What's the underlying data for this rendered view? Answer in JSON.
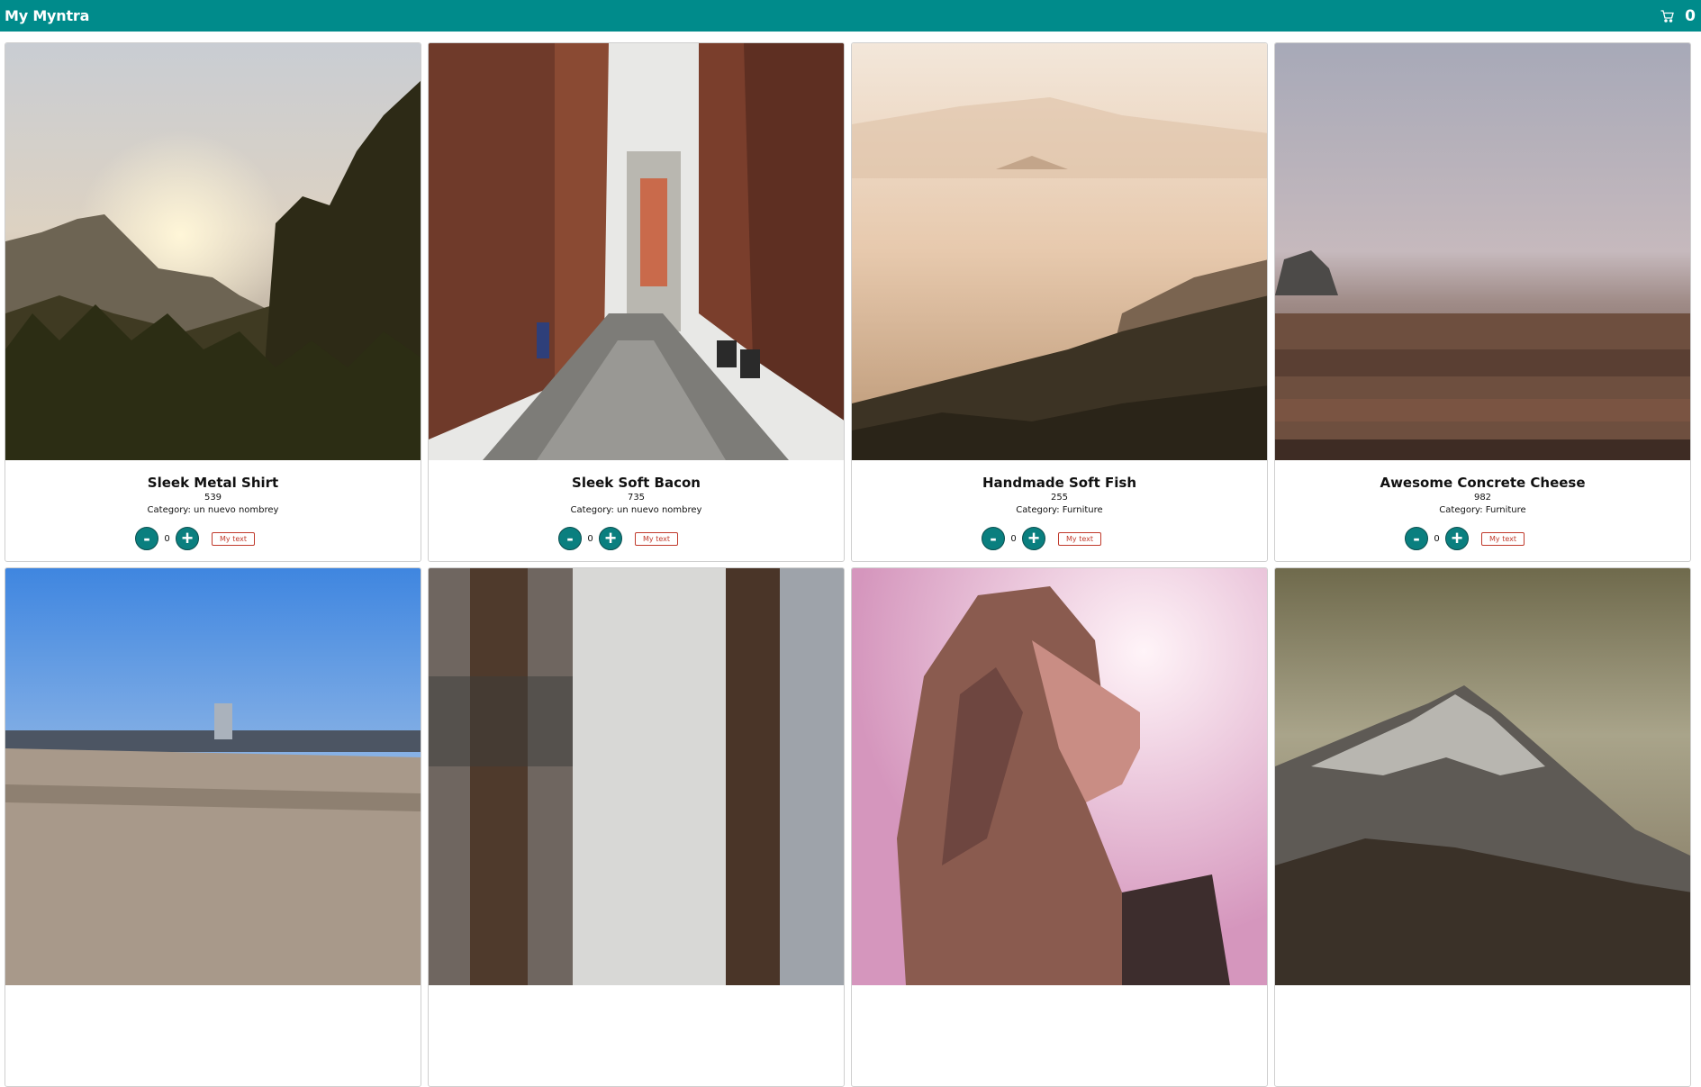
{
  "header": {
    "title": "My Myntra",
    "cart_icon": "cart-icon",
    "cart_count": "0",
    "background": "#008b8b"
  },
  "products": [
    {
      "name": "Sleek Metal Shirt",
      "price": "539",
      "category": "Category: un nuevo nombrey",
      "quantity": "0",
      "minus_label": "-",
      "plus_label": "+",
      "extra_button": "My text",
      "image": "mountain-sunset-photo"
    },
    {
      "name": "Sleek Soft Bacon",
      "price": "735",
      "category": "Category: un nuevo nombrey",
      "quantity": "0",
      "minus_label": "-",
      "plus_label": "+",
      "extra_button": "My text",
      "image": "brick-alley-photo"
    },
    {
      "name": "Handmade Soft Fish",
      "price": "255",
      "category": "Category: Furniture",
      "quantity": "0",
      "minus_label": "-",
      "plus_label": "+",
      "extra_button": "My text",
      "image": "misty-hills-photo"
    },
    {
      "name": "Awesome Concrete Cheese",
      "price": "982",
      "category": "Category: Furniture",
      "quantity": "0",
      "minus_label": "-",
      "plus_label": "+",
      "extra_button": "My text",
      "image": "foggy-field-photo"
    },
    {
      "image": "pier-sky-photo"
    },
    {
      "image": "window-curtain-photo"
    },
    {
      "image": "woman-sunlight-photo"
    },
    {
      "image": "mountain-peak-photo"
    }
  ]
}
